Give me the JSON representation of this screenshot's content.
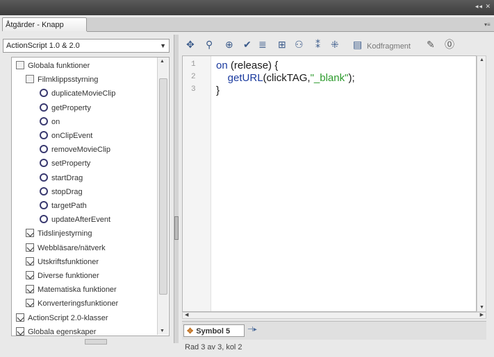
{
  "panel": {
    "tab_title": "Åtgärder - Knapp",
    "window_controls": "◂◂ ✕",
    "menu_glyph": "▾≡"
  },
  "language_select": {
    "value": "ActionScript 1.0 & 2.0"
  },
  "tree": {
    "items": [
      {
        "label": "Globala funktioner",
        "icon": "book-icon",
        "level": 0
      },
      {
        "label": "Filmklippsstyrning",
        "icon": "book-icon",
        "level": 1
      },
      {
        "label": "duplicateMovieClip",
        "icon": "function-icon",
        "level": 2
      },
      {
        "label": "getProperty",
        "icon": "function-icon",
        "level": 2
      },
      {
        "label": "on",
        "icon": "function-icon",
        "level": 2
      },
      {
        "label": "onClipEvent",
        "icon": "function-icon",
        "level": 2
      },
      {
        "label": "removeMovieClip",
        "icon": "function-icon",
        "level": 2
      },
      {
        "label": "setProperty",
        "icon": "function-icon",
        "level": 2
      },
      {
        "label": "startDrag",
        "icon": "function-icon",
        "level": 2
      },
      {
        "label": "stopDrag",
        "icon": "function-icon",
        "level": 2
      },
      {
        "label": "targetPath",
        "icon": "function-icon",
        "level": 2
      },
      {
        "label": "updateAfterEvent",
        "icon": "function-icon",
        "level": 2
      },
      {
        "label": "Tidslinjestyrning",
        "icon": "folder-icon",
        "level": 1
      },
      {
        "label": "Webbläsare/nätverk",
        "icon": "folder-icon",
        "level": 1
      },
      {
        "label": "Utskriftsfunktioner",
        "icon": "folder-icon",
        "level": 1
      },
      {
        "label": "Diverse funktioner",
        "icon": "folder-icon",
        "level": 1
      },
      {
        "label": "Matematiska funktioner",
        "icon": "folder-icon",
        "level": 1
      },
      {
        "label": "Konverteringsfunktioner",
        "icon": "folder-icon",
        "level": 1
      },
      {
        "label": "ActionScript 2.0-klasser",
        "icon": "folder-icon",
        "level": 0
      },
      {
        "label": "Globala egenskaper",
        "icon": "folder-icon",
        "level": 0
      }
    ]
  },
  "toolbar": {
    "icons": [
      "add-icon",
      "find-icon",
      "target-icon",
      "check-syntax-icon",
      "auto-format-icon",
      "code-hint-icon",
      "debug-options-icon",
      "collapse-icon",
      "expand-icon",
      "code-snippets-icon",
      "wand-icon",
      "help-icon"
    ],
    "code_snippets_label": "Kodfragment"
  },
  "editor": {
    "line_numbers": [
      "1",
      "2",
      "3"
    ],
    "lines": [
      {
        "kw1": "on",
        "rest": " (release) {"
      },
      {
        "indent": "    ",
        "kw1": "getURL",
        "rest": "(clickTAG,",
        "str": "\"_blank\"",
        "tail": ");"
      },
      {
        "rest": "}"
      }
    ]
  },
  "symbol_tab": {
    "label": "Symbol 5"
  },
  "status": {
    "text": "Rad 3 av 3, kol 2"
  }
}
